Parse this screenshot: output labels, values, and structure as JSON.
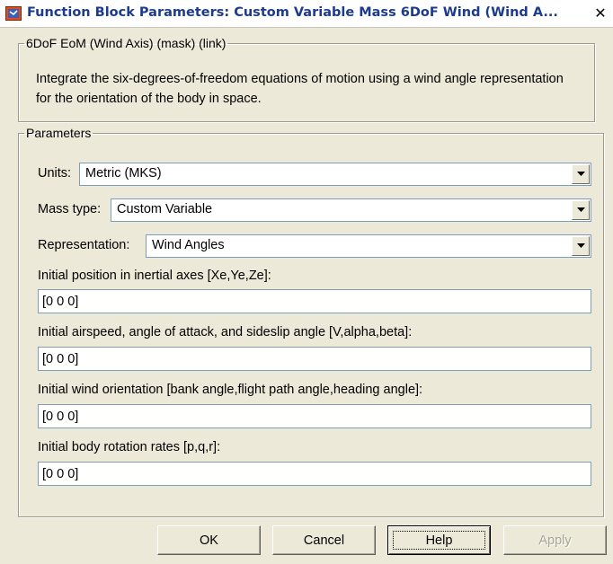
{
  "window": {
    "title": "Function Block Parameters: Custom Variable Mass 6DoF Wind (Wind A...",
    "close_glyph": "✕"
  },
  "mask_group": {
    "legend": "6DoF EoM (Wind Axis) (mask) (link)",
    "description": "Integrate the six-degrees-of-freedom equations of motion using a wind angle representation for the orientation of the body in space."
  },
  "parameters": {
    "legend": "Parameters",
    "units": {
      "label": "Units:",
      "value": "Metric (MKS)"
    },
    "mass_type": {
      "label": "Mass type:",
      "value": "Custom Variable"
    },
    "representation": {
      "label": "Representation:",
      "value": "Wind Angles"
    },
    "initial_position": {
      "label": "Initial position in inertial axes [Xe,Ye,Ze]:",
      "value": "[0 0 0]"
    },
    "initial_airspeed": {
      "label": "Initial airspeed, angle of attack, and sideslip angle [V,alpha,beta]:",
      "value": "[0 0 0]"
    },
    "initial_wind_orientation": {
      "label": "Initial wind orientation [bank angle,flight path angle,heading angle]:",
      "value": "[0 0 0]"
    },
    "initial_body_rates": {
      "label": "Initial body rotation rates [p,q,r]:",
      "value": "[0 0 0]"
    }
  },
  "buttons": {
    "ok": "OK",
    "cancel": "Cancel",
    "help": "Help",
    "apply": "Apply"
  },
  "icons": {
    "app": "simulink-block-icon",
    "dropdown": "chevron-down-icon",
    "close": "close-icon"
  },
  "colors": {
    "title_text": "#1d3b8c",
    "dialog_bg": "#ece9d8",
    "field_border": "#7f9db9"
  }
}
